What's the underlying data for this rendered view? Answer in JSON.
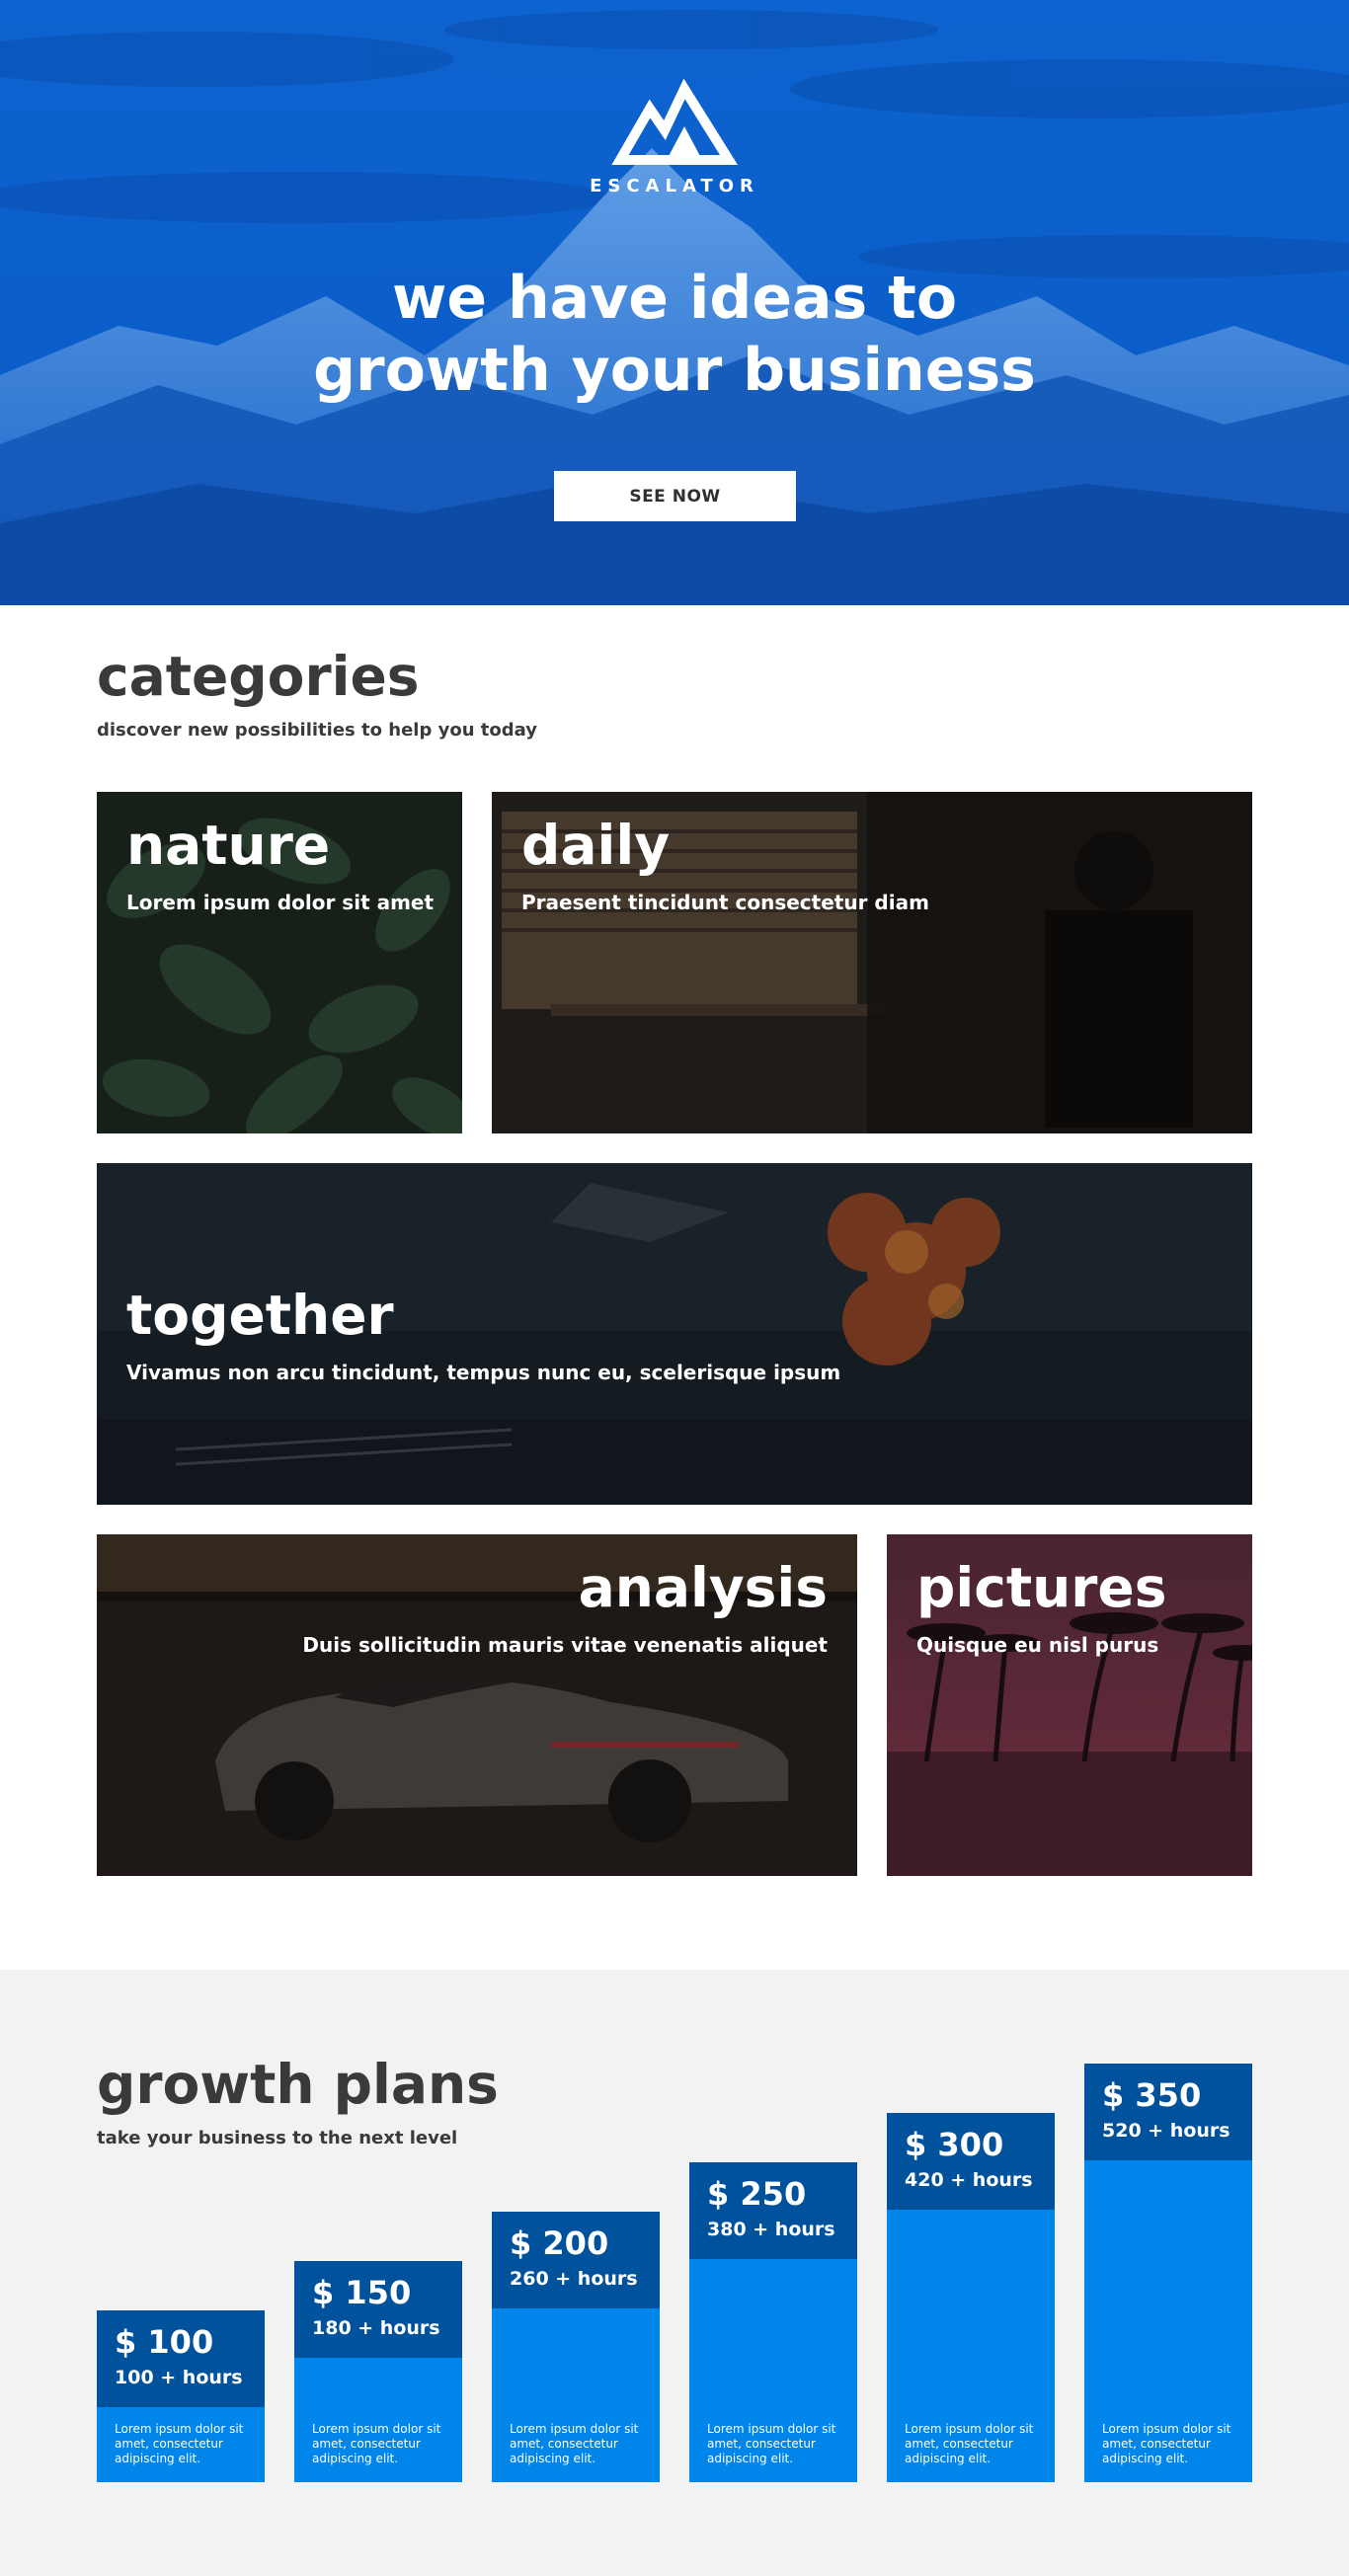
{
  "hero": {
    "brand": "ESCALATOR",
    "title_line1": "we have ideas to",
    "title_line2": "growth your business",
    "button_label": "SEE NOW",
    "background_color": "#0a5ec9"
  },
  "categories": {
    "title": "categories",
    "subtitle": "discover new possibilities to help you today",
    "cards": [
      {
        "title": "nature",
        "description": "Lorem ipsum dolor sit amet"
      },
      {
        "title": "daily",
        "description": "Praesent tincidunt consectetur diam"
      },
      {
        "title": "together",
        "description": "Vivamus non arcu tincidunt, tempus nunc eu, scelerisque ipsum"
      },
      {
        "title": "analysis",
        "description": "Duis sollicitudin mauris vitae venenatis aliquet"
      },
      {
        "title": "pictures",
        "description": "Quisque eu nisl purus"
      }
    ]
  },
  "plans": {
    "title": "growth plans",
    "subtitle": "take your business to the next level",
    "accent_color": "#0085ea",
    "header_color": "#00529c",
    "items": [
      {
        "price": "$ 100",
        "hours": "100 + hours",
        "description": "Lorem ipsum dolor sit amet, consectetur adipiscing elit."
      },
      {
        "price": "$ 150",
        "hours": "180 + hours",
        "description": "Lorem ipsum dolor sit amet, consectetur adipiscing elit."
      },
      {
        "price": "$ 200",
        "hours": "260 + hours",
        "description": "Lorem ipsum dolor sit amet, consectetur adipiscing elit."
      },
      {
        "price": "$ 250",
        "hours": "380 + hours",
        "description": "Lorem ipsum dolor sit amet, consectetur adipiscing elit."
      },
      {
        "price": "$ 300",
        "hours": "420 + hours",
        "description": "Lorem ipsum dolor sit amet, consectetur adipiscing elit."
      },
      {
        "price": "$ 350",
        "hours": "520 + hours",
        "description": "Lorem ipsum dolor sit amet, consectetur adipiscing elit."
      }
    ]
  }
}
